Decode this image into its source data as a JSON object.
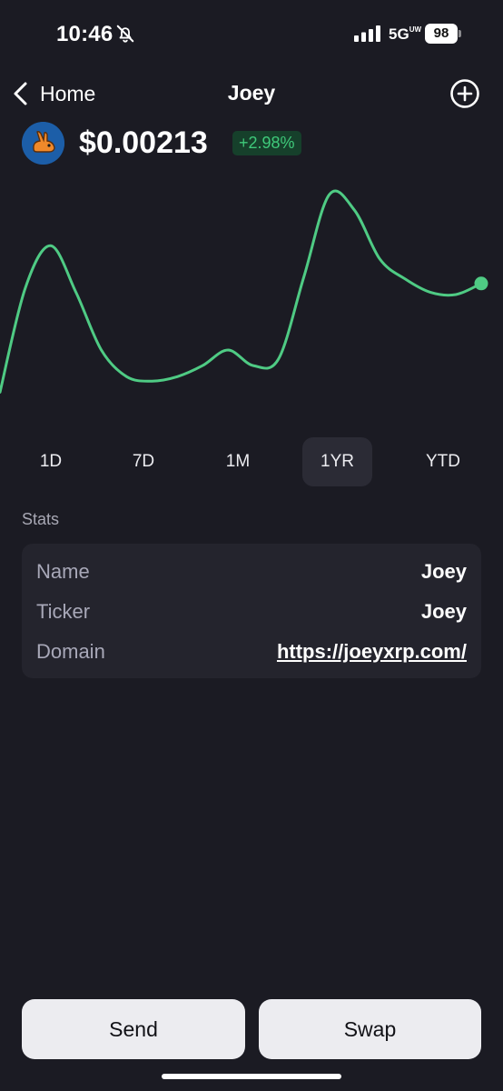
{
  "status_bar": {
    "time": "10:46",
    "network": "5G",
    "network_superscript": "UW",
    "battery": "98",
    "icons": [
      "bell-slash-icon",
      "signal-icon"
    ]
  },
  "nav": {
    "back_label": "Home",
    "title": "Joey",
    "back_icon": "chevron-left-icon",
    "add_icon": "plus-circle-icon"
  },
  "token": {
    "price": "$0.00213",
    "change": "+2.98%",
    "avatar_icon": "rabbit-logo-icon"
  },
  "chart_data": {
    "type": "line",
    "series": [
      {
        "values": [
          6,
          53,
          72,
          51,
          25,
          13,
          11,
          13,
          18,
          25,
          18,
          21,
          58,
          95,
          88,
          66,
          57,
          51,
          50,
          55
        ]
      }
    ],
    "ylim": [
      0,
      100
    ],
    "grid": false,
    "line_color": "#4fcb84",
    "endpoint_marker": true
  },
  "range_tabs": {
    "items": [
      "1D",
      "7D",
      "1M",
      "1YR",
      "YTD"
    ],
    "selected": "1YR"
  },
  "stats": {
    "heading": "Stats",
    "rows": [
      {
        "label": "Name",
        "value": "Joey"
      },
      {
        "label": "Ticker",
        "value": "Joey"
      },
      {
        "label": "Domain",
        "value": "https://joeyxrp.com/"
      }
    ]
  },
  "actions": {
    "send": "Send",
    "swap": "Swap"
  },
  "colors": {
    "background": "#1b1b23",
    "card": "#24242d",
    "accent_green": "#3fc97a",
    "button": "#ececf0"
  }
}
